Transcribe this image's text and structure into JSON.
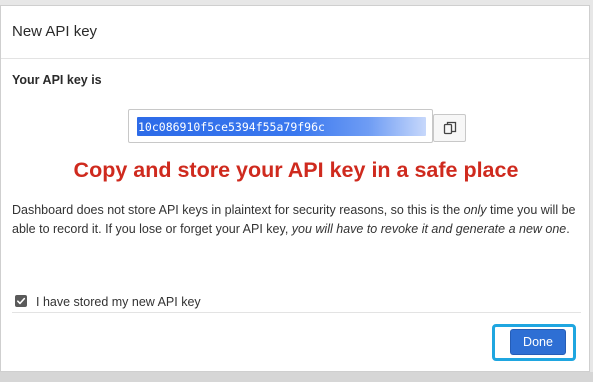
{
  "dialog": {
    "title": "New API key",
    "key_label": "Your API key is",
    "api_key": "10c086910f5ce5394f55a79f96c",
    "warning": "Copy and store your API key in a safe place",
    "description": {
      "part1": "Dashboard does not store API keys in plaintext for security reasons, so this is the ",
      "part2": "only",
      "part3": " time you will be able to record it. If you lose or forget your API key, ",
      "part4": "you will have to revoke it and generate a new one",
      "part5": "."
    },
    "checkbox_label": "I have stored my new API key",
    "checkbox_checked": true,
    "done_label": "Done"
  },
  "colors": {
    "warning": "#cf2a1e",
    "primary_button": "#2e6fd4",
    "highlight_border": "#1fa6e0",
    "selection": "#2d6be8"
  },
  "icons": {
    "copy": "copy-icon",
    "checkmark": "checkmark-icon"
  }
}
